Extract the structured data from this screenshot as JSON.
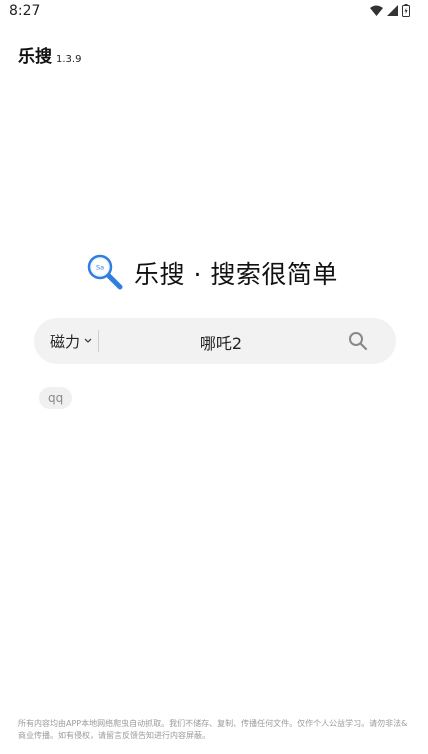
{
  "status_bar": {
    "time": "8:27"
  },
  "header": {
    "title": "乐搜",
    "version": "1.3.9"
  },
  "hero": {
    "logo_text": "Sa",
    "slogan": "乐搜 · 搜索很简单"
  },
  "search": {
    "mode": "磁力",
    "query": "哪吒2"
  },
  "history": [
    {
      "label": "qq"
    }
  ],
  "disclaimer": "所有内容均由APP本地网络爬虫自动抓取。我们不储存、复制、传播任何文件。仅作个人公益学习。请勿非法&商业传播。如有侵权，请留言反馈告知进行内容屏蔽。",
  "colors": {
    "accent": "#2f7fe0",
    "handle": "#2f7fe0"
  }
}
